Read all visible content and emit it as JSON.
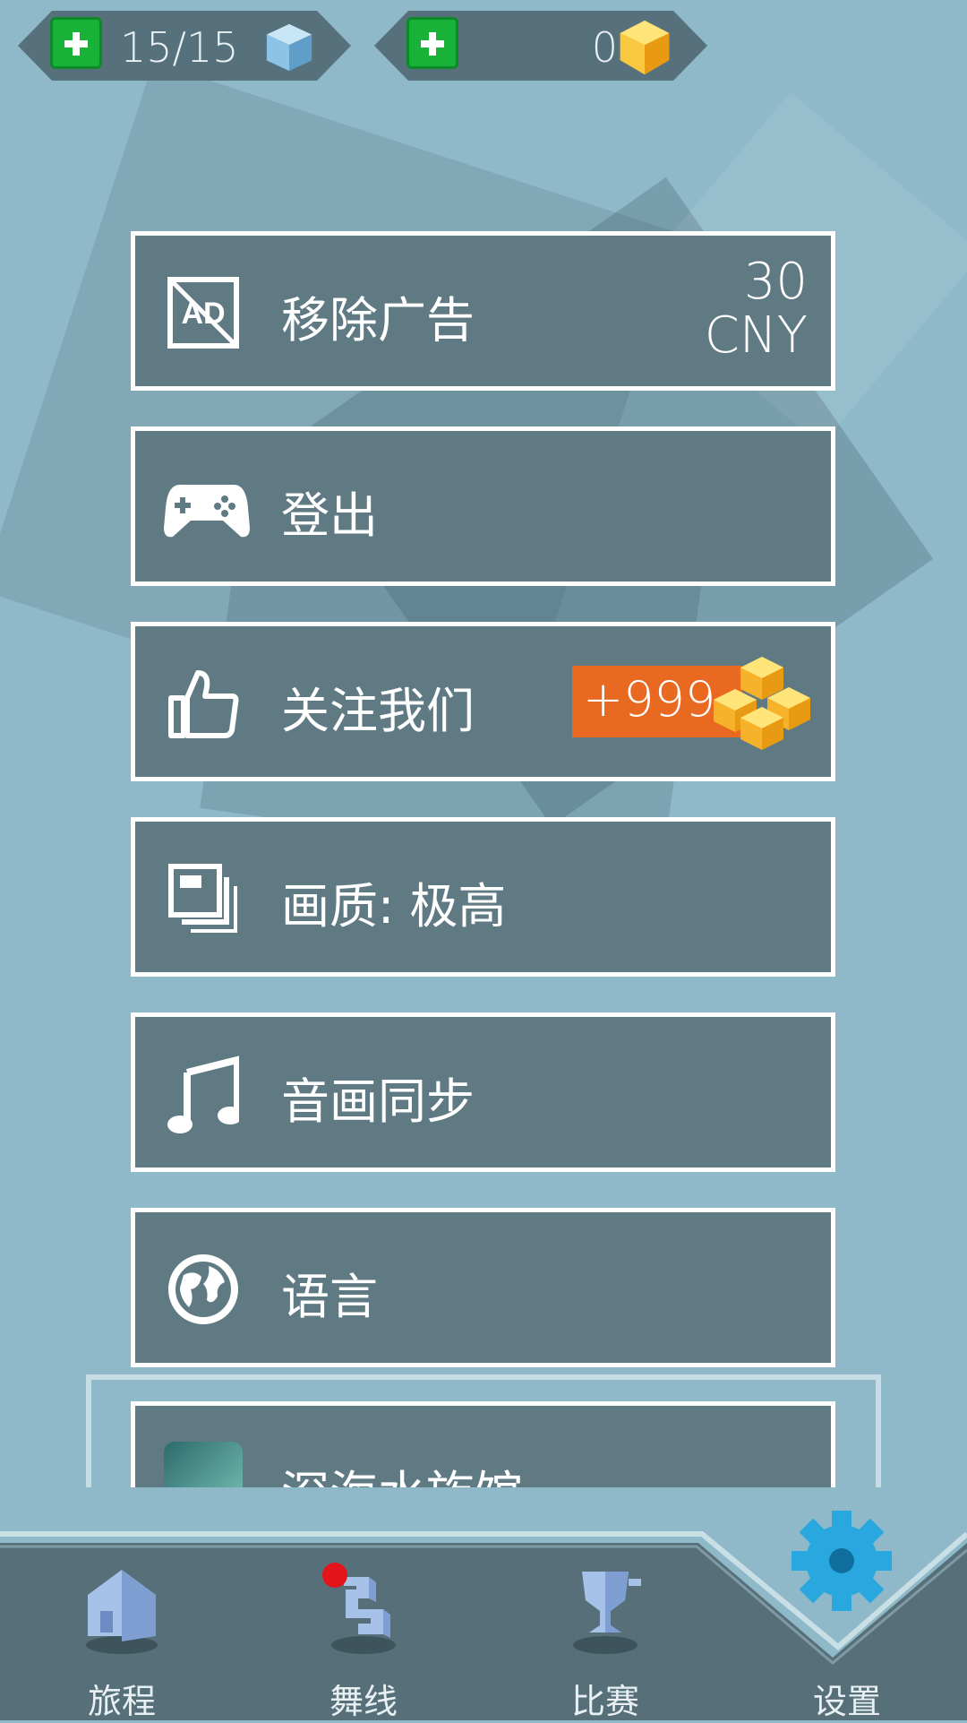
{
  "resources": {
    "life": {
      "value": "15/15",
      "icon": "ice-cube-icon",
      "add_icon": "plus-icon"
    },
    "gems": {
      "value": "0",
      "icon": "gold-gem-icon",
      "add_icon": "plus-icon"
    }
  },
  "menu": {
    "remove_ads": {
      "label": "移除广告",
      "price_amount": "30",
      "price_currency": "CNY",
      "icon": "no-ads-icon"
    },
    "logout": {
      "label": "登出",
      "icon": "gamepad-icon"
    },
    "follow_us": {
      "label": "关注我们",
      "reward": "+999",
      "icon": "thumbs-up-icon"
    },
    "quality": {
      "label": "画质: 极高",
      "icon": "quality-icon"
    },
    "av_sync": {
      "label": "音画同步",
      "icon": "music-note-icon"
    },
    "language": {
      "label": "语言",
      "icon": "globe-icon"
    },
    "promo": {
      "label": "深海水族馆",
      "icon": "whale-thumbnail"
    }
  },
  "bottom_nav": [
    {
      "label": "旅程",
      "icon": "house-icon"
    },
    {
      "label": "舞线",
      "icon": "dance-line-icon",
      "notification": true
    },
    {
      "label": "比赛",
      "icon": "trophy-icon"
    },
    {
      "label": "设置",
      "icon": "gear-icon",
      "active": true
    }
  ],
  "colors": {
    "background": "#8fb9c8",
    "panel": "#5f7a83",
    "plus_green": "#18b238",
    "reward_orange": "#e8691f",
    "active_gear": "#29a8e0"
  }
}
